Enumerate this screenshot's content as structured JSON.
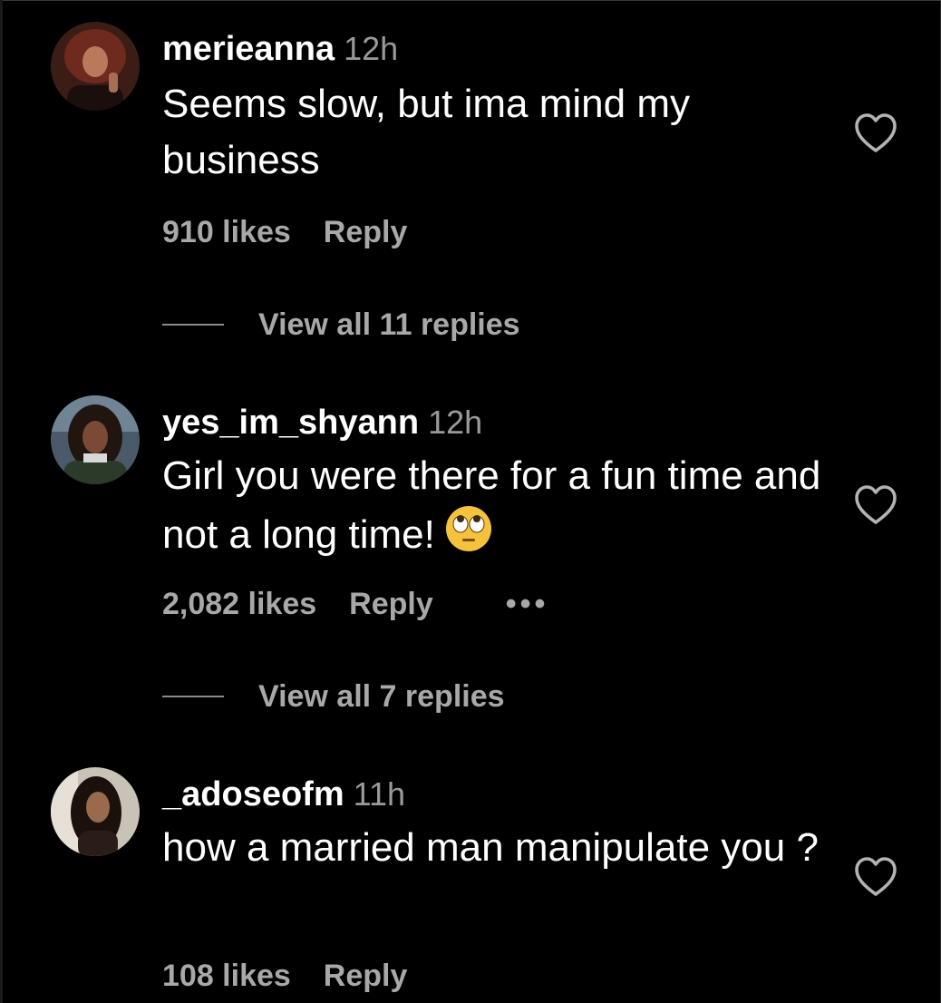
{
  "comments": [
    {
      "username": "merieanna",
      "time": "12h",
      "text": "Seems slow, but ima mind my business",
      "likes": "910 likes",
      "reply_label": "Reply",
      "view_replies": "View all 11 replies",
      "avatar_icon": "avatar-photo"
    },
    {
      "username": "yes_im_shyann",
      "time": "12h",
      "text": "Girl you were there for a fun time and not a long time!",
      "emoji": "face-with-rolling-eyes",
      "likes": "2,082 likes",
      "reply_label": "Reply",
      "more_label": "•••",
      "view_replies": "View all 7 replies",
      "avatar_icon": "avatar-photo"
    },
    {
      "username": "_adoseofm",
      "time": "11h",
      "text": "how a married man manipulate you ?",
      "likes": "108 likes",
      "reply_label": "Reply",
      "avatar_icon": "avatar-photo"
    }
  ],
  "icons": {
    "like": "heart-outline-icon",
    "more": "more-options-icon"
  },
  "colors": {
    "background": "#000000",
    "primary_text": "#ffffff",
    "secondary_text": "#a8a8a8"
  }
}
